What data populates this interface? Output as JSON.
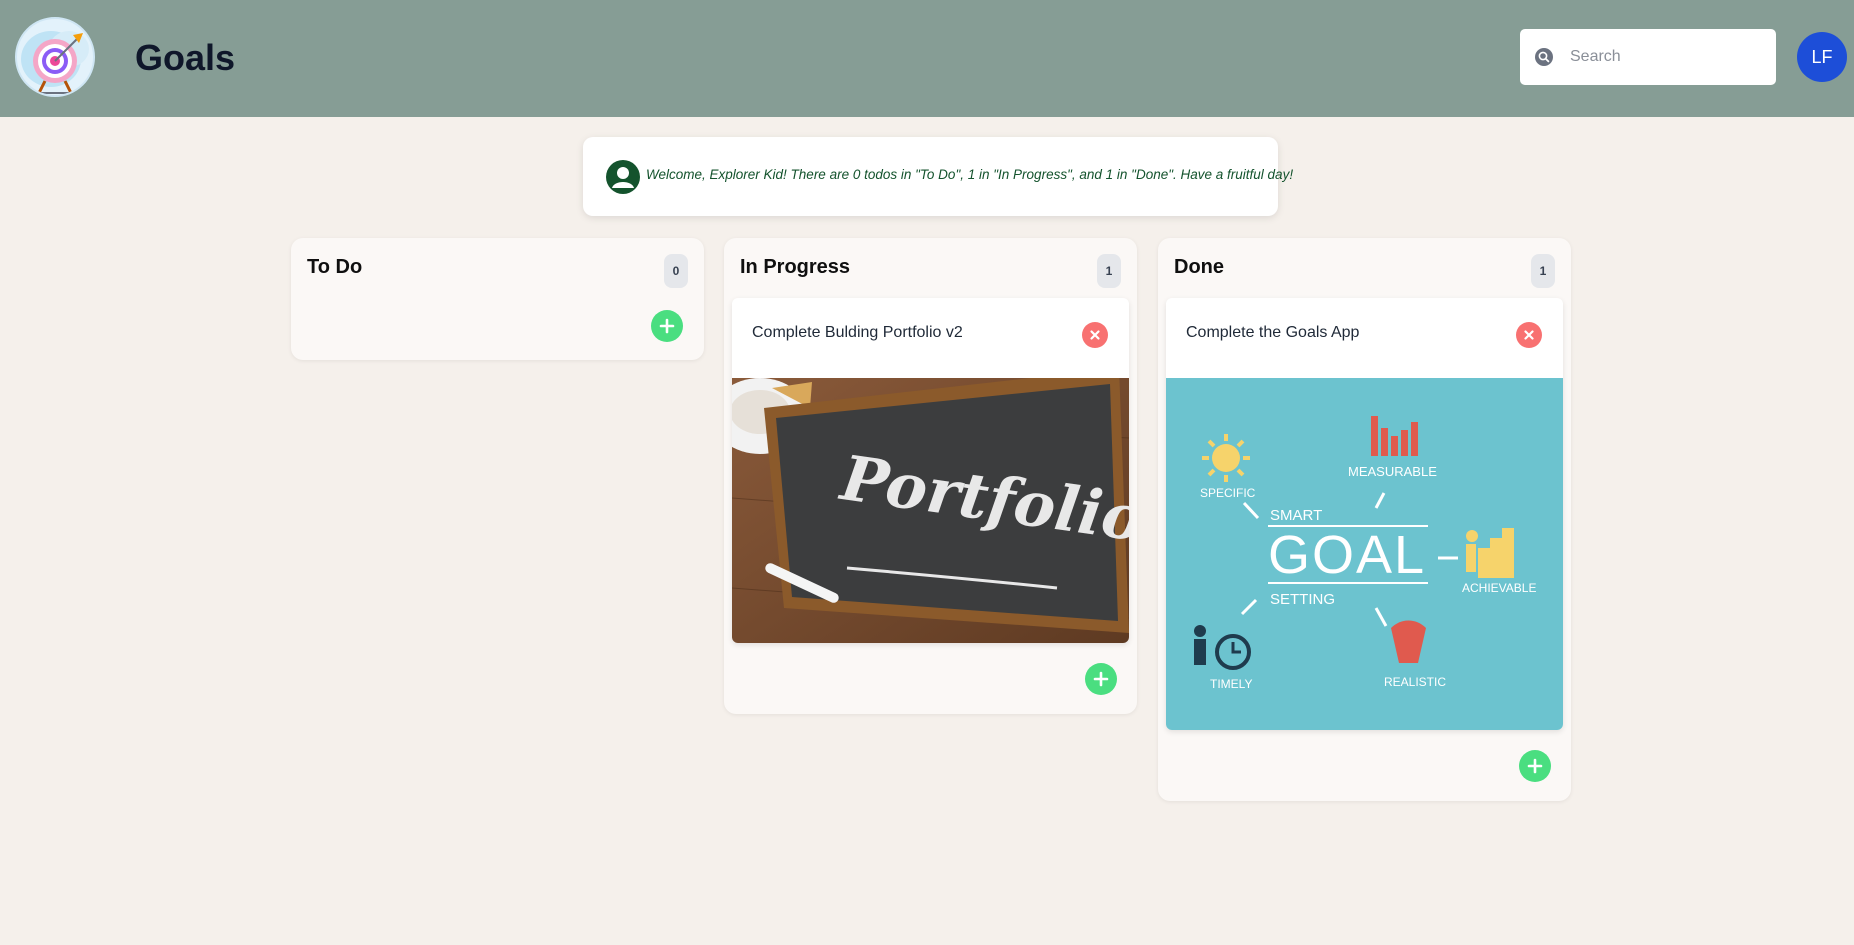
{
  "header": {
    "title": "Goals",
    "search_placeholder": "Search",
    "avatar_initials": "LF",
    "colors": {
      "header_bg": "#869d95",
      "avatar_bg": "#1d4ed8"
    }
  },
  "welcome": {
    "message": "Welcome, Explorer Kid! There are 0 todos in \"To Do\", 1 in \"In Progress\", and 1 in \"Done\". Have a fruitful day!"
  },
  "columns": [
    {
      "title": "To Do",
      "count": "0",
      "cards": []
    },
    {
      "title": "In Progress",
      "count": "1",
      "cards": [
        {
          "title": "Complete Bulding Portfolio v2",
          "image_text": "Portfolio"
        }
      ]
    },
    {
      "title": "Done",
      "count": "1",
      "cards": [
        {
          "title": "Complete the Goals App",
          "image_labels": {
            "specific": "SPECIFIC",
            "measurable": "MEASURABLE",
            "smart": "SMART",
            "goal": "GOAL",
            "setting": "SETTING",
            "achievable": "ACHIEVABLE",
            "timely": "TIMELY",
            "realistic": "REALISTIC"
          }
        }
      ]
    }
  ],
  "icons": {
    "logo": "target-logo-icon",
    "search": "search-icon",
    "welcome": "user-circle-icon",
    "add": "plus-icon",
    "delete": "close-icon"
  },
  "colors": {
    "page_bg": "#f5f0eb",
    "add_button": "#4ade80",
    "delete_button": "#f87171",
    "welcome_text": "#14532d"
  }
}
